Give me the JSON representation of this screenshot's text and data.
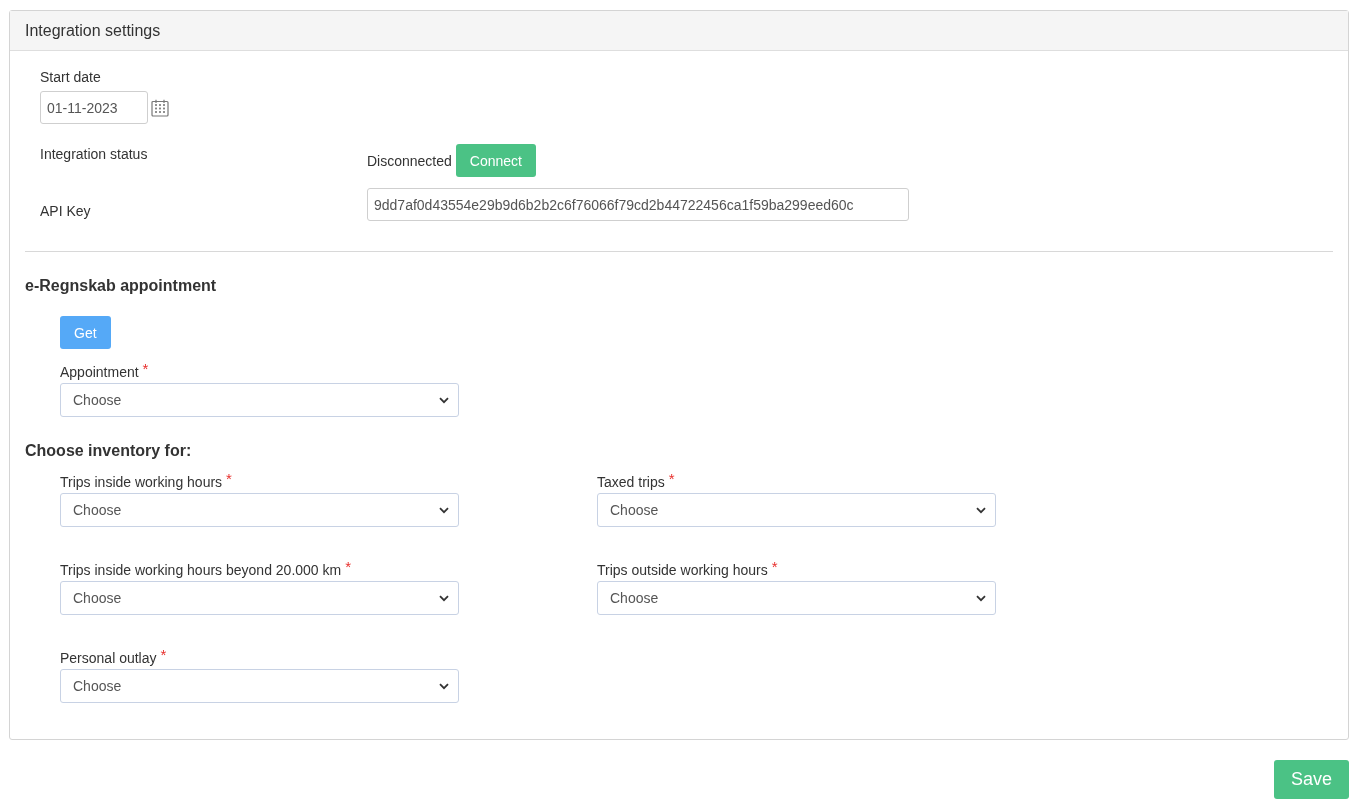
{
  "panel": {
    "title": "Integration settings"
  },
  "start_date": {
    "label": "Start date",
    "value": "01-11-2023"
  },
  "integration_status": {
    "label": "Integration status",
    "status": "Disconnected",
    "button": "Connect"
  },
  "api_key": {
    "label": "API Key",
    "value": "9dd7af0d43554e29b9d6b2b2c6f76066f79cd2b44722456ca1f59ba299eed60c"
  },
  "appointment_section": {
    "heading": "e-Regnskab appointment",
    "button": "Get",
    "field": {
      "label": "Appointment",
      "required_mark": "*",
      "value": "Choose"
    }
  },
  "inventory_section": {
    "heading": "Choose inventory for:",
    "fields": [
      {
        "label": "Trips inside working hours",
        "required_mark": "*",
        "value": "Choose"
      },
      {
        "label": "Taxed trips",
        "required_mark": "*",
        "value": "Choose"
      },
      {
        "label": "Trips inside working hours beyond 20.000 km",
        "required_mark": "*",
        "value": "Choose"
      },
      {
        "label": "Trips outside working hours",
        "required_mark": "*",
        "value": "Choose"
      },
      {
        "label": "Personal outlay",
        "required_mark": "*",
        "value": "Choose"
      }
    ]
  },
  "save_button": "Save"
}
